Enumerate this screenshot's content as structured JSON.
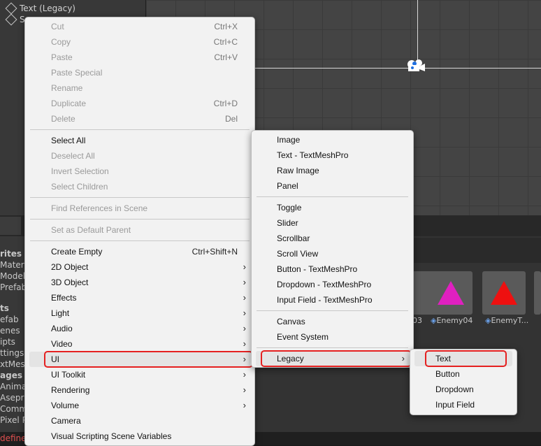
{
  "hierarchy": {
    "items": [
      {
        "label": "Text (Legacy)"
      },
      {
        "label": "S"
      }
    ]
  },
  "project_panel": {
    "left_labels": [
      "rites",
      "Materi",
      "Model",
      "Prefab",
      "ts",
      "efab",
      "enes",
      "ipts",
      "ttings",
      "xtMesh",
      "ages",
      "Anima",
      "Asepr",
      "Comm",
      "Pixel P"
    ],
    "assets": [
      {
        "label": "03"
      },
      {
        "label": "Enemy04",
        "color": "#e020c0"
      },
      {
        "label": "EnemyT...",
        "color": "#ee1010"
      }
    ]
  },
  "status_bar": {
    "text": "define"
  },
  "main_menu": {
    "groups": [
      [
        {
          "label": "Cut",
          "shortcut": "Ctrl+X",
          "enabled": false
        },
        {
          "label": "Copy",
          "shortcut": "Ctrl+C",
          "enabled": false
        },
        {
          "label": "Paste",
          "shortcut": "Ctrl+V",
          "enabled": false
        },
        {
          "label": "Paste Special",
          "shortcut": "",
          "enabled": false
        },
        {
          "label": "Rename",
          "shortcut": "",
          "enabled": false
        },
        {
          "label": "Duplicate",
          "shortcut": "Ctrl+D",
          "enabled": false
        },
        {
          "label": "Delete",
          "shortcut": "Del",
          "enabled": false
        }
      ],
      [
        {
          "label": "Select All",
          "shortcut": "",
          "enabled": true
        },
        {
          "label": "Deselect All",
          "shortcut": "",
          "enabled": false
        },
        {
          "label": "Invert Selection",
          "shortcut": "",
          "enabled": false
        },
        {
          "label": "Select Children",
          "shortcut": "",
          "enabled": false
        }
      ],
      [
        {
          "label": "Find References in Scene",
          "shortcut": "",
          "enabled": false
        }
      ],
      [
        {
          "label": "Set as Default Parent",
          "shortcut": "",
          "enabled": false
        }
      ],
      [
        {
          "label": "Create Empty",
          "shortcut": "Ctrl+Shift+N",
          "enabled": true
        },
        {
          "label": "2D Object",
          "submenu": true,
          "enabled": true
        },
        {
          "label": "3D Object",
          "submenu": true,
          "enabled": true
        },
        {
          "label": "Effects",
          "submenu": true,
          "enabled": true
        },
        {
          "label": "Light",
          "submenu": true,
          "enabled": true
        },
        {
          "label": "Audio",
          "submenu": true,
          "enabled": true
        },
        {
          "label": "Video",
          "submenu": true,
          "enabled": true
        },
        {
          "label": "UI",
          "submenu": true,
          "enabled": true,
          "highlighted": true
        },
        {
          "label": "UI Toolkit",
          "submenu": true,
          "enabled": true
        },
        {
          "label": "Rendering",
          "submenu": true,
          "enabled": true
        },
        {
          "label": "Volume",
          "submenu": true,
          "enabled": true
        },
        {
          "label": "Camera",
          "shortcut": "",
          "enabled": true
        },
        {
          "label": "Visual Scripting Scene Variables",
          "shortcut": "",
          "enabled": true
        }
      ]
    ]
  },
  "ui_menu": {
    "groups": [
      [
        {
          "label": "Image"
        },
        {
          "label": "Text - TextMeshPro"
        },
        {
          "label": "Raw Image"
        },
        {
          "label": "Panel"
        }
      ],
      [
        {
          "label": "Toggle"
        },
        {
          "label": "Slider"
        },
        {
          "label": "Scrollbar"
        },
        {
          "label": "Scroll View"
        },
        {
          "label": "Button - TextMeshPro"
        },
        {
          "label": "Dropdown - TextMeshPro"
        },
        {
          "label": "Input Field - TextMeshPro"
        }
      ],
      [
        {
          "label": "Canvas"
        },
        {
          "label": "Event System"
        }
      ],
      [
        {
          "label": "Legacy",
          "submenu": true,
          "highlighted": true
        }
      ]
    ]
  },
  "legacy_menu": {
    "items": [
      {
        "label": "Text",
        "highlighted": true
      },
      {
        "label": "Button"
      },
      {
        "label": "Dropdown"
      },
      {
        "label": "Input Field"
      }
    ]
  },
  "colors": {
    "highlight_outline": "#e52020",
    "menu_bg": "#f2f2f2"
  }
}
